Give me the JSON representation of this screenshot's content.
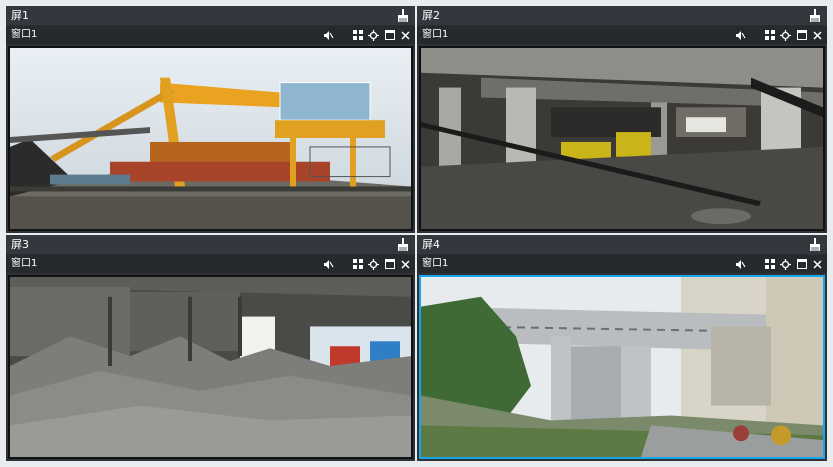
{
  "screens": [
    {
      "title": "屏1",
      "window": "窗口1"
    },
    {
      "title": "屏2",
      "window": "窗口1"
    },
    {
      "title": "屏3",
      "window": "窗口1"
    },
    {
      "title": "屏4",
      "window": "窗口1"
    }
  ],
  "icons": {
    "clean": "broom-icon",
    "sound": "speaker-icon",
    "grid": "grid-layout-icon",
    "ptz": "ptz-direction-icon",
    "max": "maximize-icon",
    "close": "close-icon"
  },
  "colors": {
    "selected_border": "#17a6ea",
    "header_bg": "#34383e",
    "window_bar_bg": "#26292d"
  },
  "selected_screen": "屏4"
}
